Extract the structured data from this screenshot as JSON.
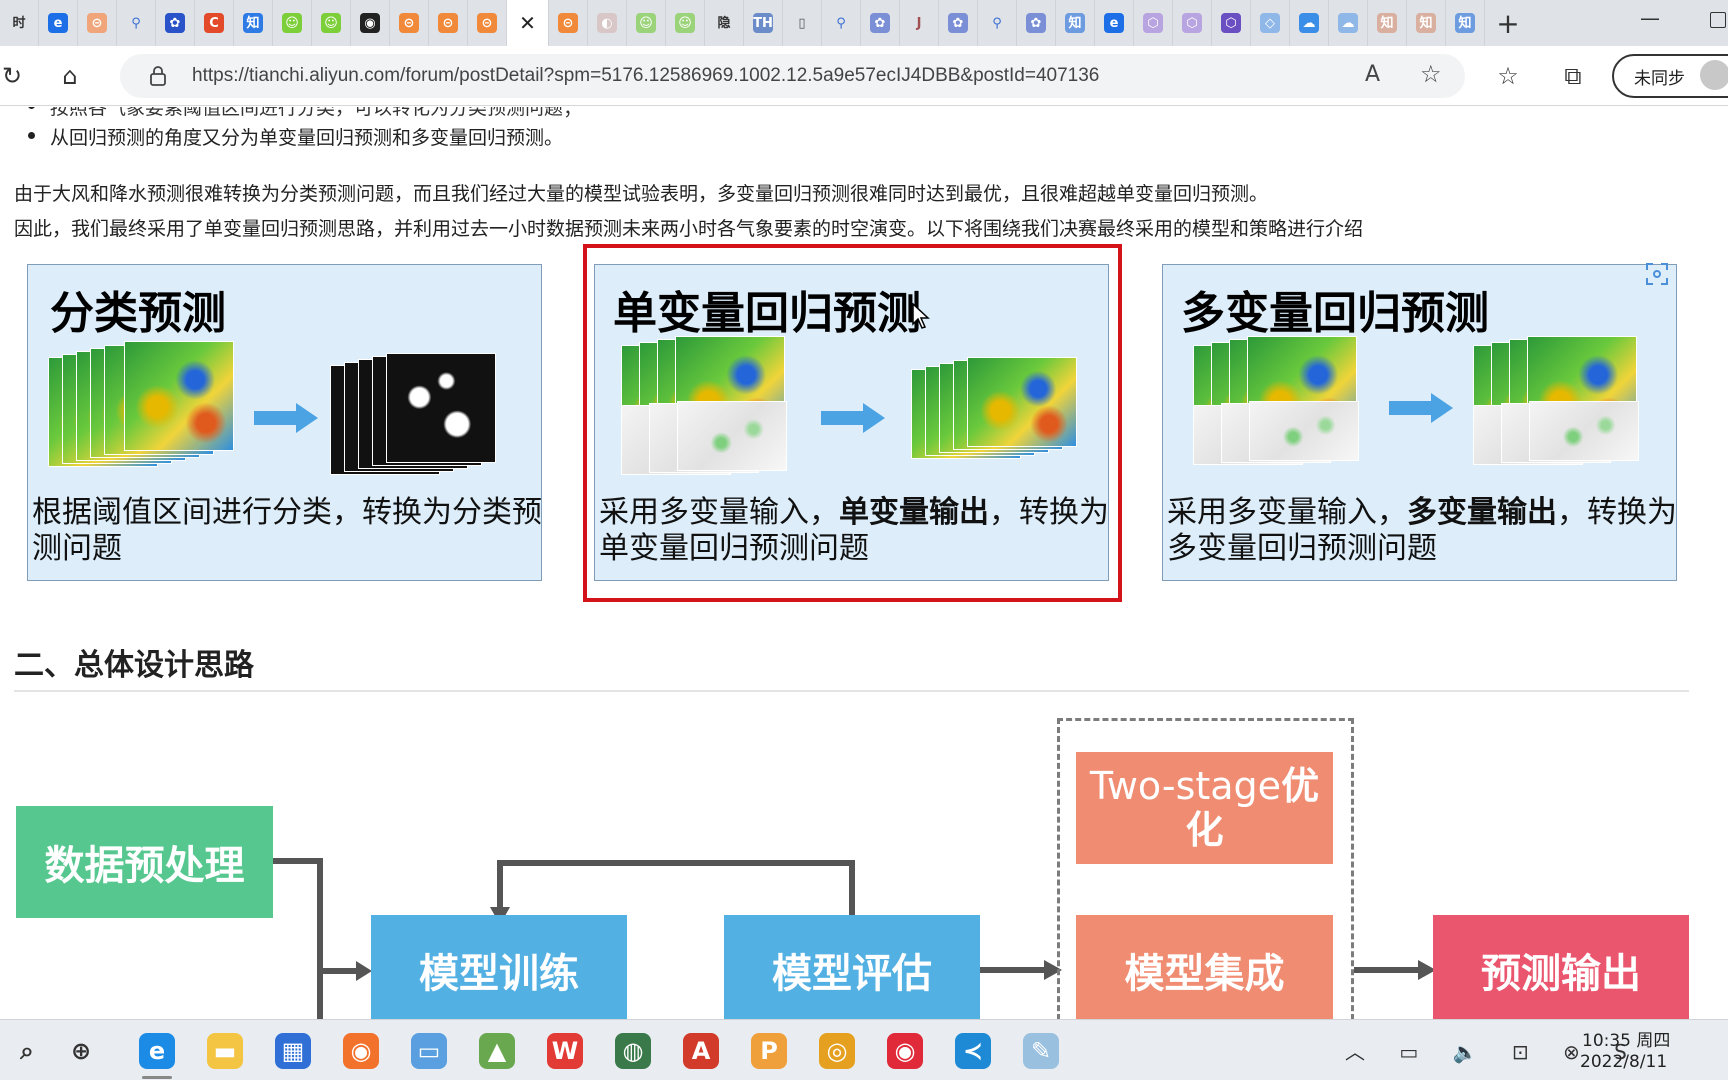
{
  "browser": {
    "tabs": [
      {
        "label": "时",
        "color": "#dfe3e8",
        "fg": "#333"
      },
      {
        "label": "e",
        "color": "#1c6fe6",
        "fg": "#fff"
      },
      {
        "label": "⊝",
        "color": "#f0a67a",
        "fg": "#fff"
      },
      {
        "label": "⚲",
        "color": "#dfe3e8",
        "fg": "#3b6fd4"
      },
      {
        "label": "✿",
        "color": "#2a52c9",
        "fg": "#fff"
      },
      {
        "label": "C",
        "color": "#e24a2a",
        "fg": "#fff"
      },
      {
        "label": "知",
        "color": "#2e7be5",
        "fg": "#fff"
      },
      {
        "label": "☺",
        "color": "#7ccf38",
        "fg": "#fff"
      },
      {
        "label": "☺",
        "color": "#7ccf38",
        "fg": "#fff"
      },
      {
        "label": "◉",
        "color": "#222",
        "fg": "#fff"
      },
      {
        "label": "⊝",
        "color": "#f08a3a",
        "fg": "#fff"
      },
      {
        "label": "⊝",
        "color": "#f08a3a",
        "fg": "#fff"
      },
      {
        "label": "⊝",
        "color": "#f08a3a",
        "fg": "#fff"
      },
      {
        "label": "✕",
        "color": "#ffffff",
        "fg": "#222",
        "active": true
      },
      {
        "label": "⊝",
        "color": "#f08a3a",
        "fg": "#fff"
      },
      {
        "label": "◐",
        "color": "#d9c7c7",
        "fg": "#fff"
      },
      {
        "label": "☺",
        "color": "#9bd37a",
        "fg": "#fff"
      },
      {
        "label": "☺",
        "color": "#9bd37a",
        "fg": "#fff"
      },
      {
        "label": "隐",
        "color": "#dfe3e8",
        "fg": "#333"
      },
      {
        "label": "TH",
        "color": "#6b8cc9",
        "fg": "#fff"
      },
      {
        "label": "▯",
        "color": "#dfe3e8",
        "fg": "#555"
      },
      {
        "label": "⚲",
        "color": "#dfe3e8",
        "fg": "#3b6fd4"
      },
      {
        "label": "✿",
        "color": "#7b8fd6",
        "fg": "#fff"
      },
      {
        "label": "J",
        "color": "#dfe3e8",
        "fg": "#a05050"
      },
      {
        "label": "✿",
        "color": "#7b8fd6",
        "fg": "#fff"
      },
      {
        "label": "⚲",
        "color": "#dfe3e8",
        "fg": "#3b6fd4"
      },
      {
        "label": "✿",
        "color": "#7b8fd6",
        "fg": "#fff"
      },
      {
        "label": "知",
        "color": "#6d9be0",
        "fg": "#fff"
      },
      {
        "label": "e",
        "color": "#1c6fe6",
        "fg": "#fff"
      },
      {
        "label": "⬡",
        "color": "#b7a4e0",
        "fg": "#fff"
      },
      {
        "label": "⬡",
        "color": "#b7a4e0",
        "fg": "#fff"
      },
      {
        "label": "⬡",
        "color": "#6a4fc2",
        "fg": "#fff"
      },
      {
        "label": "◇",
        "color": "#8fb8e8",
        "fg": "#fff"
      },
      {
        "label": "☁",
        "color": "#3b8ee8",
        "fg": "#fff"
      },
      {
        "label": "☁",
        "color": "#8fb8e8",
        "fg": "#fff"
      },
      {
        "label": "知",
        "color": "#d9b0a0",
        "fg": "#fff"
      },
      {
        "label": "知",
        "color": "#d9b0a0",
        "fg": "#fff"
      },
      {
        "label": "知",
        "color": "#6d9be0",
        "fg": "#fff"
      }
    ],
    "new_tab": "+",
    "minimize": "—",
    "url": "https://tianchi.aliyun.com/forum/postDetail?spm=5176.12586969.1002.12.5a9e57ecIJ4DBB&postId=407136",
    "sync_label": "未同步",
    "icons": {
      "refresh": "↻",
      "home": "⌂",
      "read_aloud": "A",
      "favorite_add": "☆",
      "favorites": "☆",
      "collections": "⧉"
    }
  },
  "article": {
    "bullet_top_partial": "按照各气象要素阈值区间进行分类，可以转化为分类预测问题；",
    "bullet_2": "从回归预测的角度又分为单变量回归预测和多变量回归预测。",
    "para_1": "由于大风和降水预测很难转换为分类预测问题，而且我们经过大量的模型试验表明，多变量回归预测很难同时达到最优，且很难超越单变量回归预测。",
    "para_2": "因此，我们最终采用了单变量回归预测思路，并利用过去一小时数据预测未来两小时各气象要素的时空演变。以下将围绕我们决赛最终采用的模型和策略进行介绍",
    "cards": [
      {
        "title": "分类预测",
        "desc_a": "根据阈值区间进行分类，转换为分类预测问题",
        "desc_bold": "",
        "desc_b": ""
      },
      {
        "title": "单变量回归预测",
        "desc_a": "采用多变量输入，",
        "desc_bold": "单变量输出",
        "desc_b": "，转换为单变量回归预测问题"
      },
      {
        "title": "多变量回归预测",
        "desc_a": "采用多变量输入，",
        "desc_bold": "多变量输出",
        "desc_b": "，转换为多变量回归预测问题"
      }
    ],
    "section_title": "二、总体设计思路",
    "flow": {
      "preprocess": "数据预处理",
      "train": "模型训练",
      "evaluate": "模型评估",
      "two_stage_a": "Two-stage",
      "two_stage_b": "优化",
      "ensemble": "模型集成",
      "output": "预测输出"
    }
  },
  "taskbar": {
    "apps": [
      {
        "name": "search",
        "glyph": "⌕",
        "color": "#e9edf1",
        "fg": "#333"
      },
      {
        "name": "search-app",
        "glyph": "⊕",
        "color": "#e9edf1",
        "fg": "#333"
      },
      {
        "name": "edge",
        "glyph": "e",
        "color": "#1c8be6",
        "fg": "#fff",
        "running": true
      },
      {
        "name": "explorer",
        "glyph": "▬",
        "color": "#f4c542",
        "fg": "#fff"
      },
      {
        "name": "store",
        "glyph": "▦",
        "color": "#2f6fd6",
        "fg": "#fff"
      },
      {
        "name": "firefox",
        "glyph": "◉",
        "color": "#f2712b",
        "fg": "#fff"
      },
      {
        "name": "remote-desktop",
        "glyph": "▭",
        "color": "#5aa0e0",
        "fg": "#fff"
      },
      {
        "name": "app-green",
        "glyph": "▲",
        "color": "#6aa84f",
        "fg": "#fff"
      },
      {
        "name": "wps",
        "glyph": "W",
        "color": "#e23b35",
        "fg": "#fff"
      },
      {
        "name": "earth",
        "glyph": "◍",
        "color": "#3a7a4a",
        "fg": "#fff"
      },
      {
        "name": "acrobat",
        "glyph": "A",
        "color": "#d23a2a",
        "fg": "#fff"
      },
      {
        "name": "pdf-editor",
        "glyph": "P",
        "color": "#f0a03a",
        "fg": "#fff"
      },
      {
        "name": "chrome",
        "glyph": "◎",
        "color": "#e6a020",
        "fg": "#fff"
      },
      {
        "name": "netease-music",
        "glyph": "◉",
        "color": "#e02a3a",
        "fg": "#fff"
      },
      {
        "name": "vscode",
        "glyph": "≺",
        "color": "#1e8ad6",
        "fg": "#fff"
      },
      {
        "name": "paint",
        "glyph": "✎",
        "color": "#9ac0e0",
        "fg": "#fff"
      }
    ],
    "tray": "︿ ▭ 🔈 ⊡ ⊗ S",
    "time": "10:35 周四",
    "date": "2022/8/11"
  }
}
